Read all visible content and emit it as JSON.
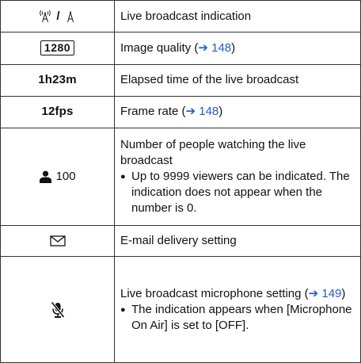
{
  "rows": [
    {
      "icon_name": "live-broadcast-icon",
      "separator": "/",
      "description": "Live broadcast indication"
    },
    {
      "icon_text": "1280",
      "description": "Image quality (",
      "link": "➔ 148",
      "description_after": ")"
    },
    {
      "icon_text": "1h23m",
      "description": "Elapsed time of the live broadcast"
    },
    {
      "icon_text": "12fps",
      "description": "Frame rate (",
      "link": "➔ 148",
      "description_after": ")"
    },
    {
      "icon_name": "viewer-person-icon",
      "icon_text": "100",
      "description": "Number of people watching the live broadcast",
      "bullet": "Up to 9999 viewers can be indicated. The indication does not appear when the number is 0."
    },
    {
      "icon_name": "envelope-icon",
      "description": "E-mail delivery setting"
    },
    {
      "icon_name": "microphone-off-icon",
      "description": "Live broadcast microphone setting (",
      "link": "➔ 149",
      "description_after": ")",
      "bullet": "The indication appears when [Microphone On Air] is set to [OFF]."
    }
  ],
  "colors": {
    "link": "#1f5fbf",
    "border": "#333333",
    "text": "#111111"
  }
}
